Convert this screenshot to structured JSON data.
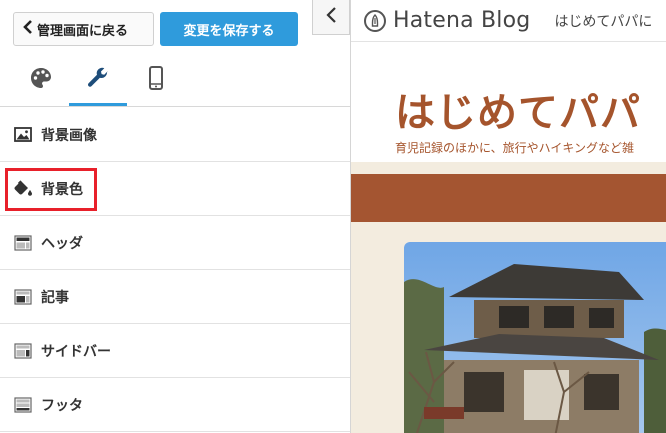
{
  "panel": {
    "back_label": "管理画面に戻る",
    "save_label": "変更を保存する"
  },
  "tabs": [
    {
      "icon": "palette-icon"
    },
    {
      "icon": "wrench-icon",
      "active": true
    },
    {
      "icon": "smartphone-icon"
    }
  ],
  "menu": [
    {
      "label": "背景画像",
      "icon": "image-icon"
    },
    {
      "label": "背景色",
      "icon": "paint-bucket-icon",
      "highlighted": true
    },
    {
      "label": "ヘッダ",
      "icon": "header-layout-icon"
    },
    {
      "label": "記事",
      "icon": "article-layout-icon"
    },
    {
      "label": "サイドバー",
      "icon": "sidebar-layout-icon"
    },
    {
      "label": "フッタ",
      "icon": "footer-layout-icon"
    }
  ],
  "preview": {
    "service_name": "Hatena Blog",
    "topbar_blog": "はじめてパパに",
    "blog_title": "はじめてパパ",
    "blog_description": "育児記録のほかに、旅行やハイキングなど雑",
    "colors": {
      "accent": "#a45531",
      "background": "#f3ecdf",
      "save_button": "#2f9bdc",
      "highlight": "#e8202a"
    }
  }
}
